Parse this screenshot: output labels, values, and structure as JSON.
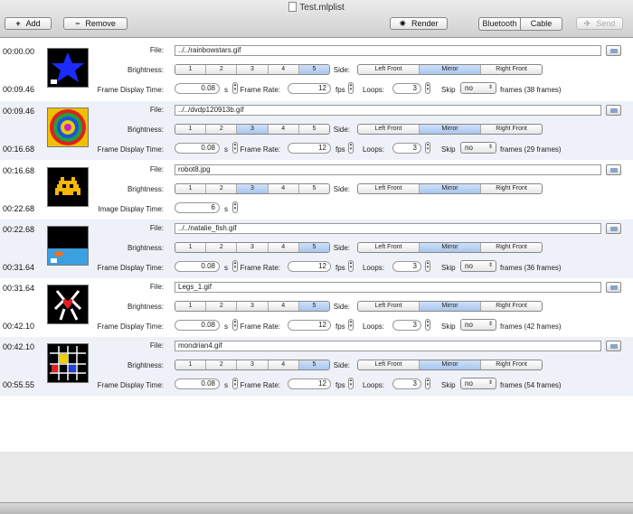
{
  "window": {
    "title": "Test.mlplist"
  },
  "toolbar": {
    "add_label": "Add",
    "add_icon": "+",
    "remove_label": "Remove",
    "remove_icon": "−",
    "render_label": "Render",
    "render_icon": "✷",
    "bluetooth_label": "Bluetooth",
    "cable_label": "Cable",
    "send_label": "Send",
    "send_icon": "✈"
  },
  "labels": {
    "file": "File:",
    "brightness": "Brightness:",
    "frame_display_time": "Frame Display Time:",
    "image_display_time": "Image Display Time:",
    "side": "Side:",
    "frame_rate": "Frame Rate:",
    "loops": "Loops:",
    "skip": "Skip",
    "sec": "s",
    "fps": "fps"
  },
  "brightness_options": [
    "1",
    "2",
    "3",
    "4",
    "5"
  ],
  "side_options": [
    "Left Front",
    "Mirror",
    "Right Front"
  ],
  "rows": [
    {
      "start": "00:00.00",
      "end": "00:09.46",
      "file": "../../rainbowstars.gif",
      "brightness": 5,
      "side": "Mirror",
      "display_time": "0.08",
      "frame_rate": "12",
      "loops": "3",
      "skip": "no",
      "frames": "frames (38 frames)",
      "is_image": false
    },
    {
      "start": "00:09.46",
      "end": "00:16.68",
      "file": "../../dvdp120913b.gif",
      "brightness": 3,
      "side": "Mirror",
      "display_time": "0.08",
      "frame_rate": "12",
      "loops": "3",
      "skip": "no",
      "frames": "frames (29 frames)",
      "is_image": false
    },
    {
      "start": "00:16.68",
      "end": "00:22.68",
      "file": "robot8.jpg",
      "brightness": 3,
      "side": "Mirror",
      "display_time": "6",
      "is_image": true
    },
    {
      "start": "00:22.68",
      "end": "00:31.64",
      "file": "../../natalie_fish.gif",
      "brightness": 5,
      "side": "Mirror",
      "display_time": "0.08",
      "frame_rate": "12",
      "loops": "3",
      "skip": "no",
      "frames": "frames (36 frames)",
      "is_image": false
    },
    {
      "start": "00:31.64",
      "end": "00:42.10",
      "file": "Legs_1.gif",
      "brightness": 5,
      "side": "Mirror",
      "display_time": "0.08",
      "frame_rate": "12",
      "loops": "3",
      "skip": "no",
      "frames": "frames (42 frames)",
      "is_image": false
    },
    {
      "start": "00:42.10",
      "end": "00:55.55",
      "file": "mondrian4.gif",
      "brightness": 5,
      "side": "Mirror",
      "display_time": "0.08",
      "frame_rate": "12",
      "loops": "3",
      "skip": "no",
      "frames": "frames (54 frames)",
      "is_image": false
    }
  ],
  "thumb_icons": [
    "star-thumb-icon",
    "spiral-thumb-icon",
    "space-invader-thumb-icon",
    "fish-thumb-icon",
    "legs-heart-thumb-icon",
    "mondrian-grid-thumb-icon"
  ],
  "colors": {
    "selected_segment": "#a9c6ee",
    "row_alt": "#eef1f7"
  }
}
